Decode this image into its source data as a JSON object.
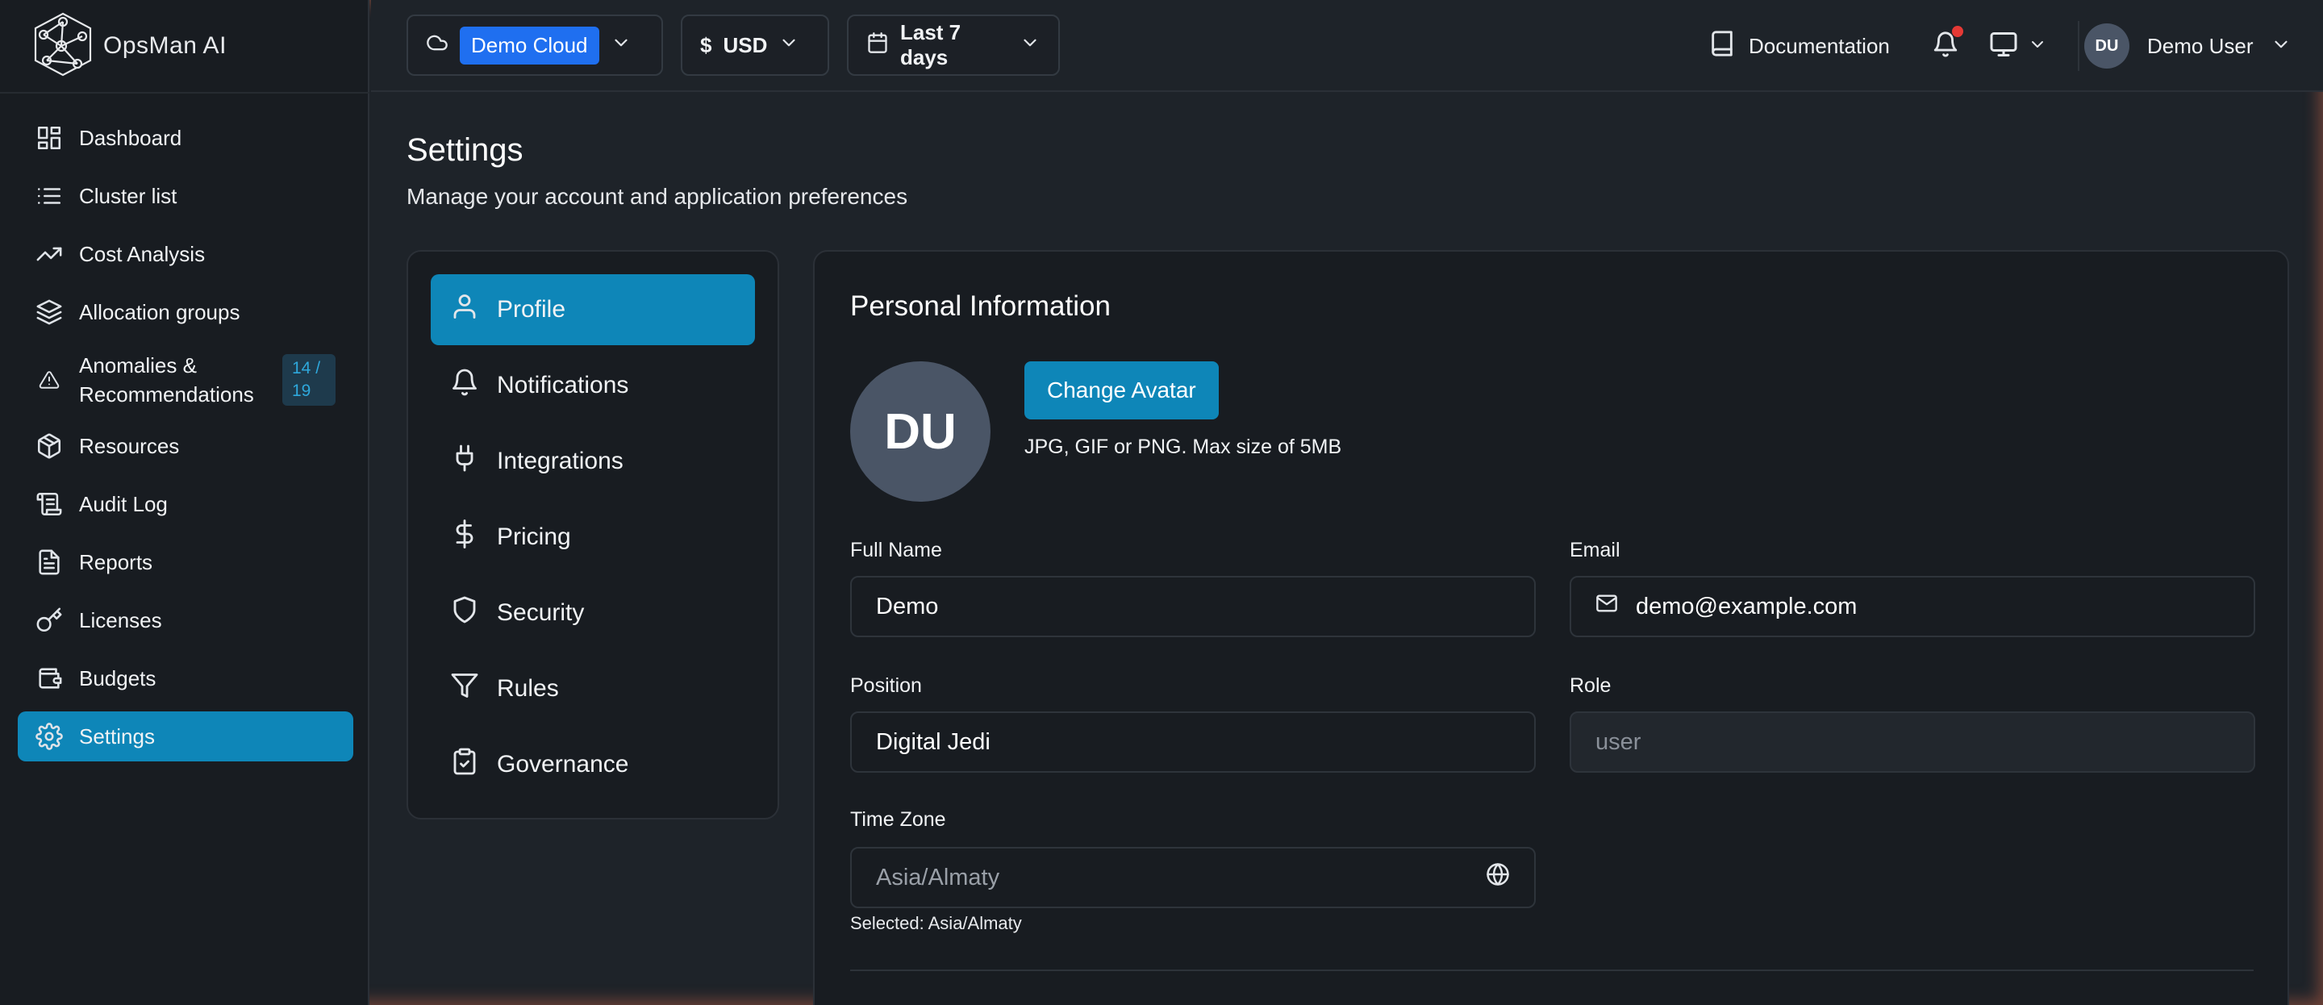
{
  "app": {
    "name": "OpsMan AI"
  },
  "sidebar": {
    "items": [
      {
        "label": "Dashboard",
        "icon": "dashboard-icon"
      },
      {
        "label": "Cluster list",
        "icon": "list-icon"
      },
      {
        "label": "Cost Analysis",
        "icon": "trending-up-icon"
      },
      {
        "label": "Allocation groups",
        "icon": "layers-icon"
      },
      {
        "label_line1": "Anomalies &",
        "label_line2": "Recommendations",
        "badge_line1": "14 /",
        "badge_line2": "19",
        "icon": "warning-icon"
      },
      {
        "label": "Resources",
        "icon": "package-icon"
      },
      {
        "label": "Audit Log",
        "icon": "scroll-icon"
      },
      {
        "label": "Reports",
        "icon": "file-text-icon"
      },
      {
        "label": "Licenses",
        "icon": "key-icon"
      },
      {
        "label": "Budgets",
        "icon": "wallet-icon"
      },
      {
        "label": "Settings",
        "icon": "gear-icon",
        "active": true
      }
    ]
  },
  "topbar": {
    "cloud": "Demo Cloud",
    "currency_symbol": "$",
    "currency": "USD",
    "date_range": "Last 7 days",
    "documentation": "Documentation",
    "user_initials": "DU",
    "user_name": "Demo User"
  },
  "page": {
    "title": "Settings",
    "subtitle": "Manage your account and application preferences"
  },
  "settings_nav": [
    {
      "label": "Profile",
      "icon": "user-icon",
      "active": true
    },
    {
      "label": "Notifications",
      "icon": "bell-icon"
    },
    {
      "label": "Integrations",
      "icon": "plug-icon"
    },
    {
      "label": "Pricing",
      "icon": "dollar-icon"
    },
    {
      "label": "Security",
      "icon": "shield-icon"
    },
    {
      "label": "Rules",
      "icon": "filter-icon"
    },
    {
      "label": "Governance",
      "icon": "clipboard-icon"
    }
  ],
  "profile": {
    "section_title": "Personal Information",
    "avatar_initials": "DU",
    "change_avatar": "Change Avatar",
    "avatar_hint": "JPG, GIF or PNG. Max size of 5MB",
    "full_name_label": "Full Name",
    "full_name": "Demo",
    "email_label": "Email",
    "email": "demo@example.com",
    "position_label": "Position",
    "position": "Digital Jedi",
    "role_label": "Role",
    "role": "user",
    "timezone_label": "Time Zone",
    "timezone": "Asia/Almaty",
    "timezone_selected": "Selected: Asia/Almaty"
  },
  "colors": {
    "accent": "#0e86b8",
    "cloud_pill": "#1f6ff0",
    "notification_dot": "#e53935",
    "background": "#1e2329",
    "sidebar": "#181c21"
  }
}
